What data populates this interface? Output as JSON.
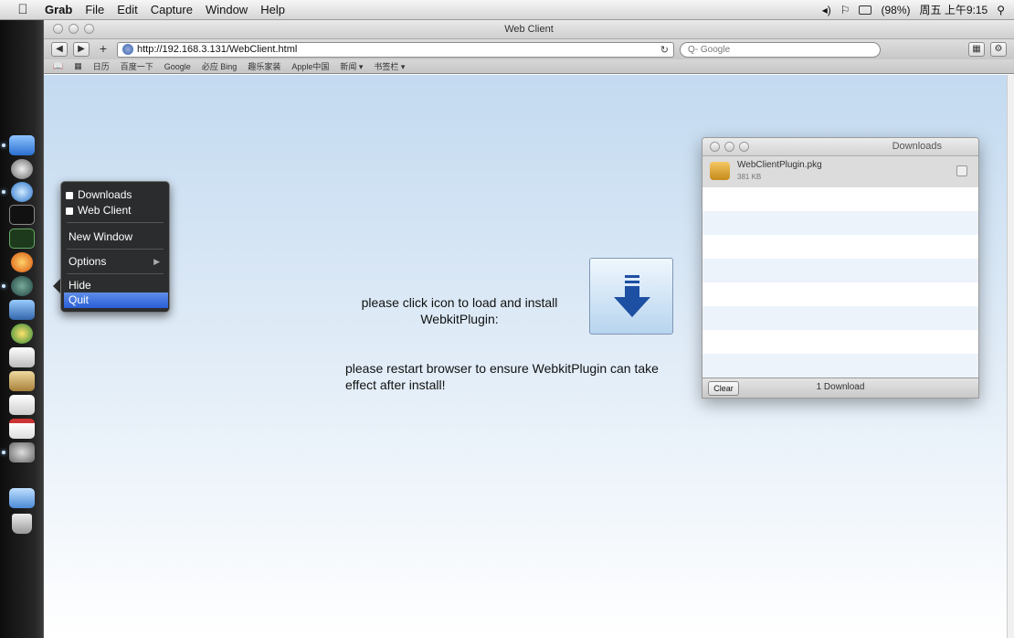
{
  "menubar": {
    "apple_icon": "apple-icon",
    "items": [
      "Grab",
      "File",
      "Edit",
      "Capture",
      "Window",
      "Help"
    ],
    "status": {
      "battery_percent": "(98%)",
      "clock": "周五 上午9:15"
    }
  },
  "browser": {
    "window_title": "Web Client",
    "url": "http://192.168.3.131/WebClient.html",
    "search_placeholder": "Q- Google",
    "bookmarks": [
      "日历",
      "百度一下",
      "Google",
      "必应 Bing",
      "趣乐家装",
      "Apple中国",
      "新闻 ▾",
      "书签栏 ▾"
    ]
  },
  "page": {
    "install_message_line1": "please click icon to load and install",
    "install_message_line2": "WebkitPlugin:",
    "restart_message_line1": "please restart browser to ensure WebkitPlugin can take",
    "restart_message_line2": "effect after install!"
  },
  "downloads": {
    "title": "Downloads",
    "item_name": "WebClientPlugin.pkg",
    "item_size": "381 KB",
    "clear_label": "Clear",
    "count_label": "1 Download"
  },
  "context_menu": {
    "windows": [
      "Downloads",
      "Web Client"
    ],
    "new_window": "New Window",
    "options": "Options",
    "hide": "Hide",
    "quit": "Quit"
  }
}
